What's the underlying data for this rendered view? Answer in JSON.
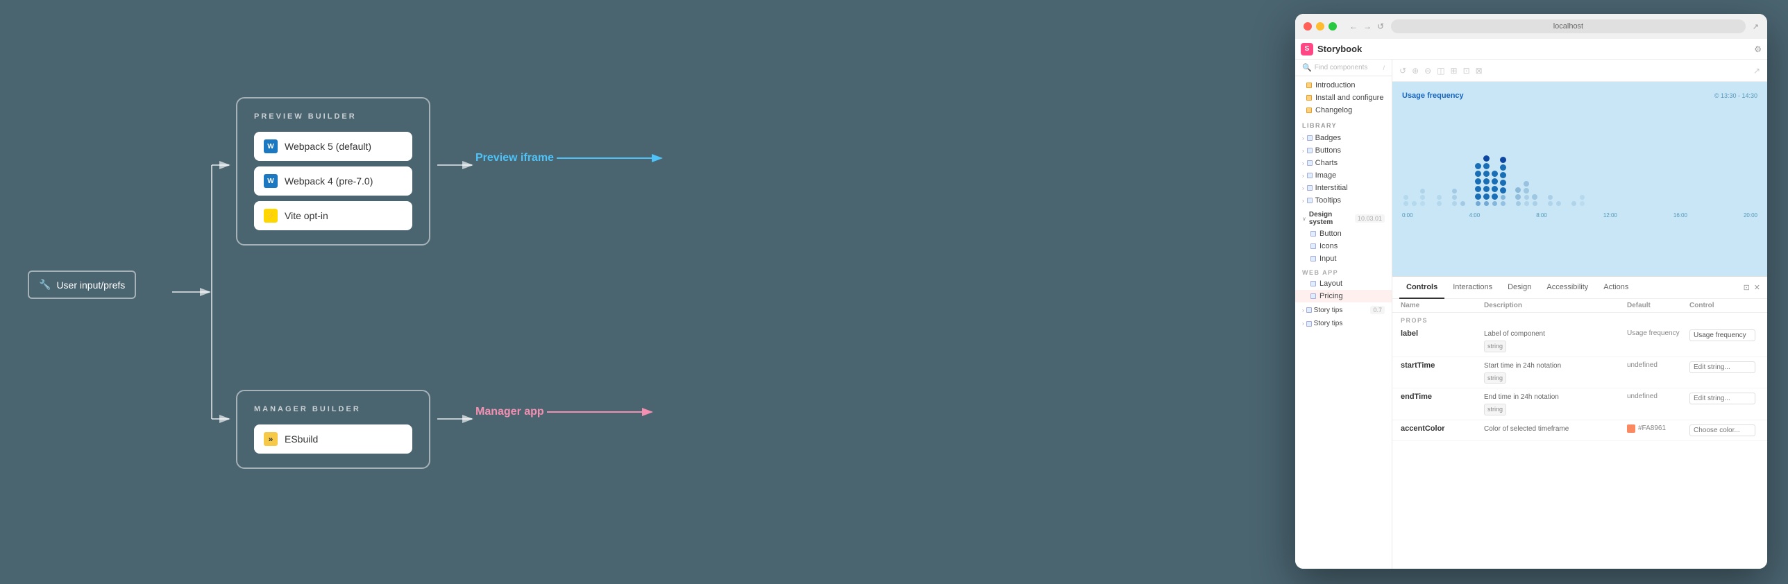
{
  "window": {
    "title": "localhost",
    "traffic_lights": [
      "red",
      "yellow",
      "green"
    ]
  },
  "diagram": {
    "user_input_label": "User input/prefs",
    "preview_builder_title": "PREVIEW BUILDER",
    "manager_builder_title": "MANAGER BUILDER",
    "preview_options": [
      {
        "id": "webpack5",
        "label": "Webpack 5 (default)",
        "icon": "webpack"
      },
      {
        "id": "webpack4",
        "label": "Webpack 4 (pre-7.0)",
        "icon": "webpack"
      },
      {
        "id": "vite",
        "label": "Vite opt-in",
        "icon": "vite"
      }
    ],
    "manager_options": [
      {
        "id": "esbuild",
        "label": "ESbuild",
        "icon": "esbuild"
      }
    ],
    "preview_iframe_label": "Preview iframe",
    "manager_app_label": "Manager app"
  },
  "storybook": {
    "logo": "Storybook",
    "search_placeholder": "Find components",
    "settings_icon": "⚙",
    "toolbar_icons": [
      "↺",
      "⊕",
      "⊖",
      "◫",
      "⊞",
      "⊡",
      "⊠",
      "↗"
    ],
    "nav": {
      "docs_section": [
        {
          "label": "Introduction",
          "icon": "book",
          "indent": 1
        },
        {
          "label": "Install and configure",
          "icon": "book",
          "indent": 1
        },
        {
          "label": "Changelog",
          "icon": "book",
          "indent": 1
        }
      ],
      "library_section_label": "LIBRARY",
      "library_items": [
        {
          "label": "Badges",
          "icon": "component",
          "expandable": true
        },
        {
          "label": "Buttons",
          "icon": "component",
          "expandable": true
        },
        {
          "label": "Charts",
          "icon": "component",
          "expandable": true
        },
        {
          "label": "Image",
          "icon": "component",
          "expandable": true
        },
        {
          "label": "Interstitial",
          "icon": "component",
          "expandable": true
        },
        {
          "label": "Tooltips",
          "icon": "component",
          "expandable": true
        }
      ],
      "design_system_section": {
        "label": "Design system",
        "version": "10.03.01",
        "items": [
          {
            "label": "Button",
            "icon": "component"
          },
          {
            "label": "Icons",
            "icon": "component"
          },
          {
            "label": "Input",
            "icon": "component"
          }
        ]
      },
      "web_app_section": {
        "label": "WEB APP",
        "items": [
          {
            "label": "Layout",
            "icon": "component"
          },
          {
            "label": "Pricing",
            "icon": "component",
            "active": true
          }
        ]
      },
      "story_tips_sections": [
        {
          "label": "Story tips",
          "version": "0.7"
        },
        {
          "label": "Story tips",
          "version": ""
        }
      ]
    },
    "preview": {
      "chart_title": "Usage frequency",
      "chart_time": "© 13:30 - 14:30",
      "x_labels": [
        "0:00",
        "4:00",
        "8:00",
        "12:00",
        "16:00",
        "20:00"
      ]
    },
    "panel": {
      "tabs": [
        "Controls",
        "Interactions",
        "Design",
        "Accessibility",
        "Actions"
      ],
      "active_tab": "Controls",
      "table_headers": [
        "Name",
        "Description",
        "Default",
        "Control"
      ],
      "section_label": "PROPS",
      "rows": [
        {
          "name": "label",
          "description": "Label of component",
          "type": "string",
          "default": "Usage frequency",
          "control": "Usage frequency"
        },
        {
          "name": "startTime",
          "description": "Start time in 24h notation",
          "type": "string",
          "default": "undefined",
          "control": "Edit string..."
        },
        {
          "name": "endTime",
          "description": "End time in 24h notation",
          "type": "string",
          "default": "undefined",
          "control": "Edit string..."
        },
        {
          "name": "accentColor",
          "description": "Color of selected timeframe",
          "type": "",
          "default": "#FA8961",
          "control": "Choose color..."
        }
      ]
    }
  }
}
